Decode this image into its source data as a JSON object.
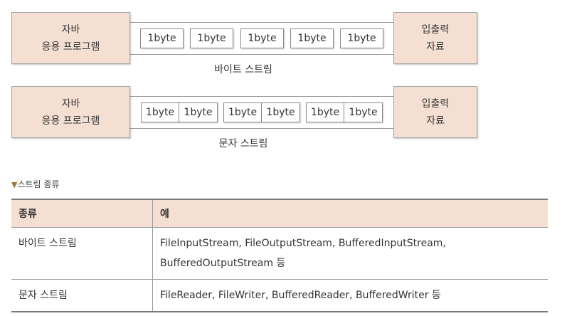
{
  "diagram": {
    "byte_stream": {
      "left_box": [
        "자바",
        "응용 프로그램"
      ],
      "right_box": [
        "입출력",
        "자료"
      ],
      "units": [
        "1byte",
        "1byte",
        "1byte",
        "1byte",
        "1byte"
      ],
      "caption": "바이트 스트림"
    },
    "char_stream": {
      "left_box": [
        "자바",
        "응용 프로그램"
      ],
      "right_box": [
        "입출력",
        "자료"
      ],
      "unit_pairs": [
        [
          "1byte",
          "1byte"
        ],
        [
          "1byte",
          "1byte"
        ],
        [
          "1byte",
          "1byte"
        ]
      ],
      "caption": "문자 스트림"
    }
  },
  "table": {
    "title_marker": "▼",
    "title": "스트림 종류",
    "headers": [
      "종류",
      "예"
    ],
    "rows": [
      {
        "kind": "바이트 스트림",
        "examples": [
          "FileInputStream, FileOutputStream, BufferedInputStream,",
          "BufferedOutputStream 등"
        ]
      },
      {
        "kind": "문자 스트림",
        "examples": [
          "FileReader, FileWriter, BufferedReader, BufferedWriter 등"
        ]
      }
    ]
  },
  "colors": {
    "box_fill": "#f5dfd3",
    "border": "#9a9a9a",
    "marker": "#a0763b"
  }
}
